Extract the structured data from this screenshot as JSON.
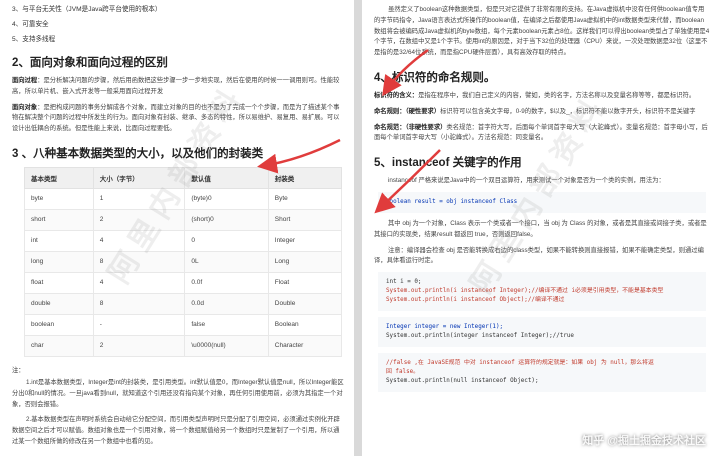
{
  "left": {
    "intro": [
      "3、与平台无关性（JVM是Java跨平台使用的根本）",
      "4、可靠安全",
      "5、支持多线程"
    ],
    "section2_title": "2、面向对象和面向过程的区别",
    "section2_p1_label": "面向过程",
    "section2_p1": "：是分析解决问题的步骤，然后用函数把这些步骤一步一步地实现，然后在使用的时候一一调用则可。性能较高，所以单片机、嵌入式开发等一般采用面向过程开发",
    "section2_p2_label": "面向对象",
    "section2_p2": "：是把构成问题的事务分解成各个对象，而建立对象的目的也不是为了完成一个个步骤，而是为了描述某个事物在解决整个问题的过程中所发生的行为。面向对象有封装、继承、多态的特性，所以易维护、易复用、易扩展。可以设计出低耦合的系统。但是性能上来说，比面向过程要低。",
    "section3_title": "3 、八种基本数据类型的大小，以及他们的封装类",
    "table": {
      "headers": [
        "基本类型",
        "大小（字节）",
        "默认值",
        "封装类"
      ],
      "rows": [
        [
          "byte",
          "1",
          "(byte)0",
          "Byte"
        ],
        [
          "short",
          "2",
          "(short)0",
          "Short"
        ],
        [
          "int",
          "4",
          "0",
          "Integer"
        ],
        [
          "long",
          "8",
          "0L",
          "Long"
        ],
        [
          "float",
          "4",
          "0.0f",
          "Float"
        ],
        [
          "double",
          "8",
          "0.0d",
          "Double"
        ],
        [
          "boolean",
          "-",
          "false",
          "Boolean"
        ],
        [
          "char",
          "2",
          "\\u0000(null)",
          "Character"
        ]
      ]
    },
    "note_label": "注：",
    "note1": "1.int是基本数据类型，Integer是int的封装类，是引用类型。int默认值是0，而Integer默认值是null，所以Integer能区分出0和null的情况。一旦java看到null，就知道这个引用还没有指向某个对象，再任何引用使用前，必须为其指定一个对象，否则会报错。",
    "note2": "2.基本数据类型在声明时系统会自动给它分配空间，而引用类型声明时只是分配了引用空间，必须通过实例化开辟数据空间之后才可以赋值。数组对象也是一个引用对象，将一个数组赋值给另一个数组时只是复制了一个引用，所以通过某一个数组所做的修改在另一个数组中也看的见。"
  },
  "right": {
    "top_para": "虽然定义了boolean这种数据类型，但是只对它提供了非常有限的支持。在Java虚拟机中没有任何供boolean值专用的字节码指令，Java语言表达式所操作的boolean值，在编译之后都使用Java虚拟机中的int数据类型来代替，而boolean数组将会被编码成Java虚拟机的byte数组，每个元素boolean元素占8位。这样我们可以得出boolean类型占了单独使用是4个字节，在数组中又是1个字节。使用int的原因是，对于当下32位的处理器（CPU）来说，一次处理数据是32位（这里不是指的是32/64位系统，而是指CPU硬件层面），具有高效存取的特点。",
    "section4_title": "4、标识符的命名规则。",
    "id_meaning_label": "标识符的含义：",
    "id_meaning": "是指在程序中，我们自己定义的内容，譬如，类的名字，方法名称以及变量名称等等，都是标识符。",
    "rule_force_label": "命名规则：（硬性要求）",
    "rule_force": "标识符可以包含英文字母，0-9的数字，$以及_，标识符不能以数字开头，标识符不是关键字",
    "rule_soft_label": "命名规范：（非硬性要求）",
    "rule_soft": "类名规范：首字符大写，后面每个单词首字母大写（大驼峰式）。变量名规范：首字母小写，后面每个单词首字母大写（小驼峰式）。方法名规范：同变量名。",
    "section5_title": "5、instanceof 关键字的作用",
    "instanceof_para": "instanceof 严格来说是Java中的一个双目运算符，用来测试一个对象是否为一个类的实例，用法为：",
    "code1": "boolean result = obj instanceof Class",
    "explain1": "其中 obj 为一个对象，Class 表示一个类或者一个接口，当 obj 为 Class 的对象，或者是其直接或间接子类，或者是其接口的实现类，结果result 都返回 true，否则返回false。",
    "explain2": "注意：编译器会检查 obj 是否能转换成右边的class类型，如果不能转换则直接报错，如果不能确定类型，则通过编译，具体看运行时定。",
    "code2": [
      "int i = 0;",
      "System.out.println(i instanceof Integer);//编译不通过  i必须是引用类型，不能是基本类型",
      "System.out.println(i instanceof Object);//编译不通过"
    ],
    "code3": [
      "Integer integer = new Integer(1);",
      "System.out.println(integer instanceof  Integer);//true"
    ],
    "code4": [
      "//false   ,在 JavaSE规范 中对 instanceof 运算符的规定就是：如果 obj 为 null，那么将返",
      "回 false。",
      "System.out.println(null instanceof Object);"
    ]
  },
  "watermark_text": "阿里内部资料",
  "bottom_watermark": "知乎 @掘土掘金技术社区",
  "colors": {
    "arrow": "#e03c3c",
    "table_header": "#f0f0f0",
    "code_bg": "#f6f8fa"
  }
}
